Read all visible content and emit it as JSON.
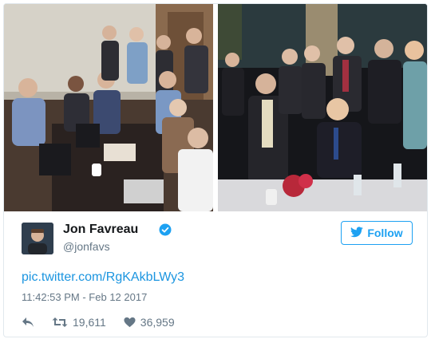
{
  "tweet": {
    "author_name": "Jon Favreau",
    "author_handle": "@jonfavs",
    "follow_label": "Follow",
    "link_text": "pic.twitter.com/RgKAkbLWy3",
    "timestamp": "11:42:53 PM - Feb 12 2017",
    "retweet_count": "19,611",
    "like_count": "36,959"
  },
  "icons": {
    "verified": "verified-badge-icon",
    "follow": "twitter-bird-icon",
    "reply": "reply-icon",
    "retweet": "retweet-icon",
    "like": "heart-icon"
  },
  "colors": {
    "accent": "#1da1f2",
    "link": "#1b95e0",
    "muted": "#657786",
    "text": "#14171a"
  }
}
